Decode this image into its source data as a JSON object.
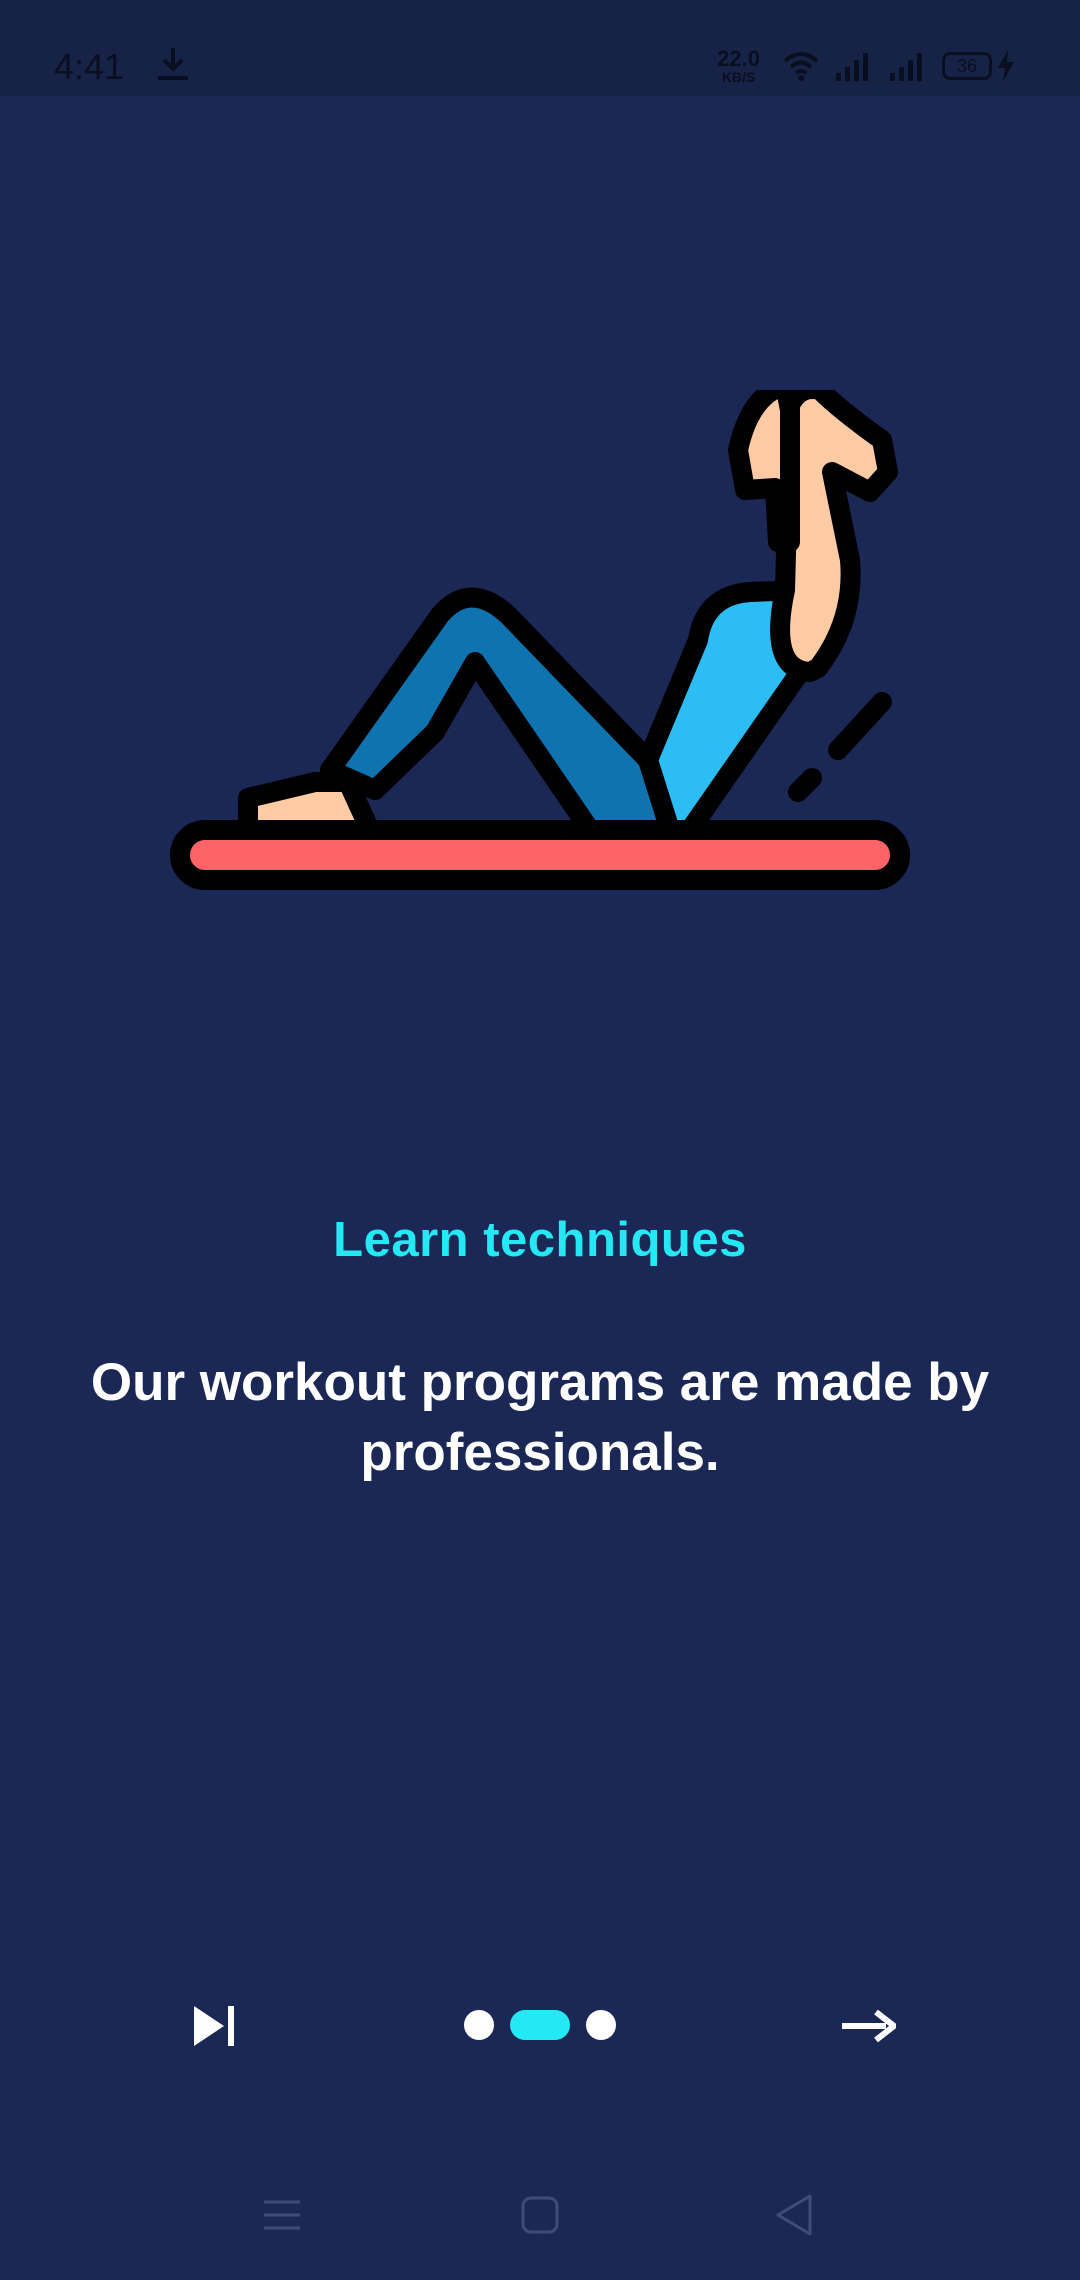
{
  "status_bar": {
    "time": "4:41",
    "network_speed_value": "22.0",
    "network_speed_unit": "KB/S",
    "battery_level": "36",
    "icons": [
      "download-icon",
      "wifi-icon",
      "signal-icon",
      "signal-icon",
      "battery-icon",
      "charging-icon"
    ]
  },
  "onboarding": {
    "subtitle": "Learn techniques",
    "description": "Our workout programs are made by professionals.",
    "page_indicator": {
      "total": 3,
      "active_index": 1
    }
  },
  "controls": {
    "skip_icon": "skip-next-icon",
    "next_icon": "arrow-right-icon"
  },
  "system_nav": {
    "icons": [
      "menu-icon",
      "home-icon",
      "back-icon"
    ]
  },
  "colors": {
    "background": "#1b2856",
    "accent": "#24e8f3",
    "text": "#ffffff",
    "mat": "#fe6467"
  }
}
